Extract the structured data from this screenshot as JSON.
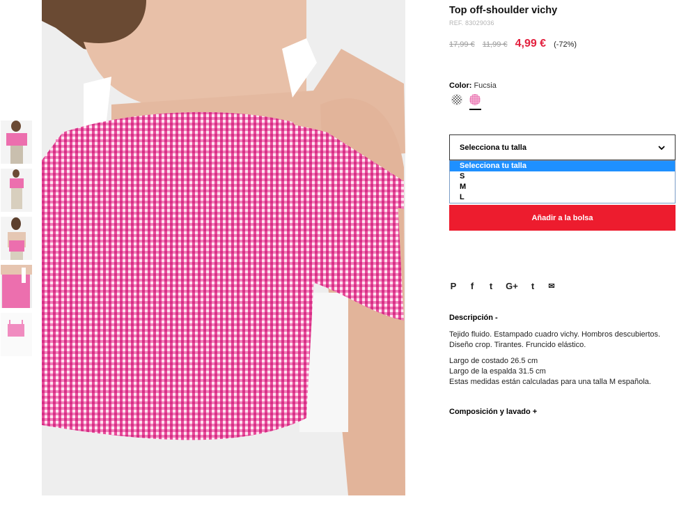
{
  "product": {
    "title": "Top off-shoulder vichy",
    "ref": "REF. 83029036",
    "price_original": "17,99 €",
    "price_previous": "11,99 €",
    "price_current": "4,99 €",
    "discount": "(-72%)"
  },
  "color": {
    "label": "Color:",
    "value": "Fucsia",
    "swatches": [
      "checkered-swatch",
      "fucsia-swatch"
    ],
    "selected": "fucsia-swatch",
    "accent": "#e96fae"
  },
  "size": {
    "select_label": "Selecciona tu talla",
    "options": [
      "Selecciona tu talla",
      "S",
      "M",
      "L"
    ],
    "highlighted": "Selecciona tu talla"
  },
  "cart": {
    "add_label": "Añadir a la bolsa",
    "button_color": "#ed1c2e"
  },
  "share": {
    "icons": [
      "pinterest-icon",
      "facebook-icon",
      "twitter-icon",
      "google-plus-icon",
      "tumblr-icon",
      "email-icon"
    ],
    "glyphs": [
      "P",
      "f",
      "t",
      "G+",
      "t",
      "✉"
    ]
  },
  "description": {
    "title": "Descripción -",
    "text": "Tejido fluido. Estampado cuadro vichy. Hombros descubiertos. Diseño crop. Tirantes. Fruncido elástico.",
    "measures": [
      "Largo de costado 26.5 cm",
      "Largo de la espalda 31.5 cm",
      "Estas medidas están calculadas para una talla M española."
    ]
  },
  "composition": {
    "title": "Composición y lavado +"
  },
  "gallery": {
    "thumbnail_count": 5,
    "main_image": "pink gingham off-shoulder top close-up"
  }
}
